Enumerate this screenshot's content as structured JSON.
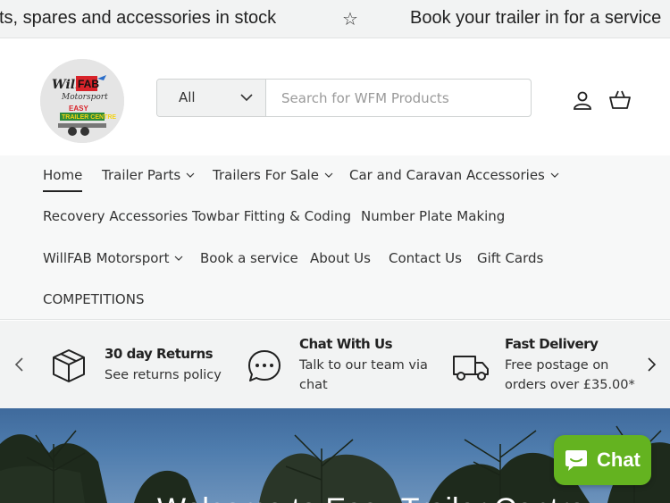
{
  "announcement": {
    "messages": [
      "ts, spares and accessories in stock",
      "Book your trailer in for a service"
    ],
    "separator_icon": "star-icon"
  },
  "header": {
    "logo_text": "WillFAB Motorsport Trailer Centre",
    "search": {
      "category_selected": "All",
      "placeholder": "Search for WFM Products"
    },
    "icons": [
      "account-icon",
      "cart-icon"
    ]
  },
  "nav": {
    "items": [
      {
        "label": "Home",
        "active": true
      },
      {
        "label": "Trailer Parts",
        "dropdown": true
      },
      {
        "label": "Trailers For Sale",
        "dropdown": true
      },
      {
        "label": "Car and Caravan Accessories",
        "dropdown": true
      },
      {
        "label": "Recovery Accessories"
      },
      {
        "label": "Towbar Fitting & Coding"
      },
      {
        "label": "Number Plate Making"
      },
      {
        "label": "WillFAB Motorsport",
        "dropdown": true
      },
      {
        "label": "Book a service"
      },
      {
        "label": "About Us"
      },
      {
        "label": "Contact Us"
      },
      {
        "label": "Gift Cards"
      },
      {
        "label": "COMPETITIONS"
      }
    ]
  },
  "usp": {
    "items": [
      {
        "title": "30 day Returns",
        "text": "See returns policy",
        "icon": "box-icon"
      },
      {
        "title": "Chat With Us",
        "text": "Talk to our team via chat",
        "icon": "chat-bubble-icon"
      },
      {
        "title": "Fast Delivery",
        "text": "Free postage on orders over £35.00*",
        "icon": "truck-icon"
      }
    ]
  },
  "hero": {
    "title": "Welcome to Easy Trailer Centre"
  },
  "chat_widget": {
    "label": "Chat"
  },
  "colors": {
    "chat_green": "#64b320",
    "announce_bg": "#f2f3f3",
    "nav_bg": "#f7f8f8"
  }
}
